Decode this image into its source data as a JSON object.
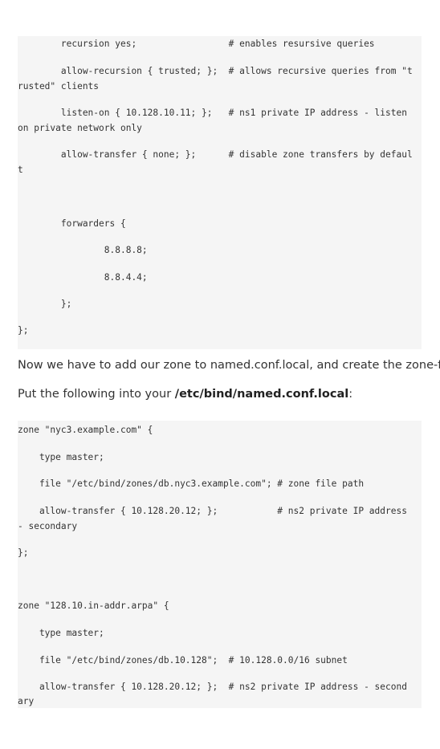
{
  "code_block_1": {
    "lines": [
      "        recursion yes;                 # enables resursive queries",
      "        allow-recursion { trusted; };  # allows recursive queries from \"t",
      "rusted\" clients",
      "        listen-on { 10.128.10.11; };   # ns1 private IP address - listen",
      "on private network only",
      "        allow-transfer { none; };      # disable zone transfers by defaul",
      "t",
      "        forwarders {",
      "                8.8.8.8;",
      "                8.8.4.4;",
      "        };",
      "};"
    ]
  },
  "paragraph_1": {
    "text": "Now we have to add our zone to named.conf.local, and create the zone-file."
  },
  "paragraph_2": {
    "prefix": "Put the following into your ",
    "path": "/etc/bind/named.conf.local",
    "suffix": ":"
  },
  "code_block_2": {
    "lines": [
      "zone \"nyc3.example.com\" {",
      "    type master;",
      "    file \"/etc/bind/zones/db.nyc3.example.com\"; # zone file path",
      "    allow-transfer { 10.128.20.12; };           # ns2 private IP address",
      "- secondary",
      "};",
      "zone \"128.10.in-addr.arpa\" {",
      "    type master;",
      "    file \"/etc/bind/zones/db.10.128\";  # 10.128.0.0/16 subnet",
      "    allow-transfer { 10.128.20.12; };  # ns2 private IP address - second",
      "ary"
    ]
  }
}
